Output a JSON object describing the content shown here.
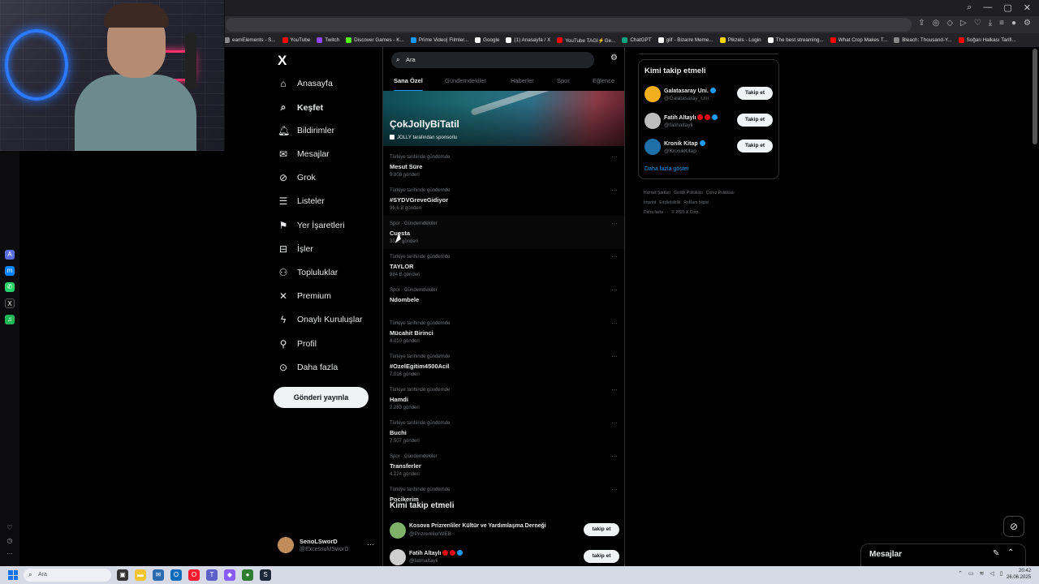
{
  "browser": {
    "bookmarks": [
      {
        "label": "eamElements - S...",
        "color": "#888888"
      },
      {
        "label": "YouTube",
        "color": "#ff0000"
      },
      {
        "label": "Twitch",
        "color": "#9146ff"
      },
      {
        "label": "Discover Games - K...",
        "color": "#53fc18"
      },
      {
        "label": "Prime Video| Filmler...",
        "color": "#1399ff"
      },
      {
        "label": "Google",
        "color": "#ffffff"
      },
      {
        "label": "(1) Anasayfa / X",
        "color": "#ffffff"
      },
      {
        "label": "YouTube TAGI⚡Ge...",
        "color": "#ff0000"
      },
      {
        "label": "ChatGPT",
        "color": "#10a37f"
      },
      {
        "label": "glif - Bizarre Meme...",
        "color": "#ffffff"
      },
      {
        "label": "Pikzels - Login",
        "color": "#ffd400"
      },
      {
        "label": "The best streaming...",
        "color": "#ffffff"
      },
      {
        "label": "What Crop Makes T...",
        "color": "#ff0000"
      },
      {
        "label": "Bleach: Thousand-Y...",
        "color": "#888888"
      },
      {
        "label": "Soğan Halkası Tarifi...",
        "color": "#ff0000"
      }
    ]
  },
  "sidebar": {
    "logo": "X",
    "items": [
      {
        "label": "Anasayfa",
        "icon": "home-icon",
        "glyph": "⌂"
      },
      {
        "label": "Keşfet",
        "icon": "search-icon",
        "glyph": "⌕",
        "active": true
      },
      {
        "label": "Bildirimler",
        "icon": "bell-icon",
        "glyph": "🔔︎"
      },
      {
        "label": "Mesajlar",
        "icon": "mail-icon",
        "glyph": "✉"
      },
      {
        "label": "Grok",
        "icon": "grok-icon",
        "glyph": "⊘"
      },
      {
        "label": "Listeler",
        "icon": "list-icon",
        "glyph": "☰"
      },
      {
        "label": "Yer İşaretleri",
        "icon": "bookmark-icon",
        "glyph": "⚑"
      },
      {
        "label": "İşler",
        "icon": "briefcase-icon",
        "glyph": "⊟"
      },
      {
        "label": "Topluluklar",
        "icon": "people-icon",
        "glyph": "⚇"
      },
      {
        "label": "Premium",
        "icon": "x-premium-icon",
        "glyph": "✕"
      },
      {
        "label": "Onaylı Kuruluşlar",
        "icon": "lightning-icon",
        "glyph": "ϟ"
      },
      {
        "label": "Profil",
        "icon": "person-icon",
        "glyph": "⚲"
      },
      {
        "label": "Daha fazla",
        "icon": "more-circle-icon",
        "glyph": "⊙"
      }
    ],
    "post_button": "Gönderi yayınla",
    "account": {
      "name": "SenoLSworD",
      "handle": "@ExcessuMSworD",
      "more": "···"
    }
  },
  "explore": {
    "search_placeholder": "Ara",
    "tabs": [
      "Sana Özel",
      "Gündemdekiler",
      "Haberler",
      "Spor",
      "Eğlence"
    ],
    "banner": {
      "title": "ÇokJollyBiTatil",
      "sponsor": "JOLLY tarafından sponsorlu"
    },
    "trends": [
      {
        "context": "Türkiye tarihinde gündemde",
        "title": "Mesut Süre",
        "count": "9.808 gönderi"
      },
      {
        "context": "Türkiye tarihinde gündemde",
        "title": "#SYDVGreveGidiyor",
        "count": "96,6 B gönderi"
      },
      {
        "context": "Spor · Gündemdekiler",
        "title": "Cuesta",
        "count": "33,... gönderi"
      },
      {
        "context": "Türkiye tarihinde gündemde",
        "title": "TAYLOR",
        "count": "984 B gönderi"
      },
      {
        "context": "Spor · Gündemdekiler",
        "title": "Ndombele",
        "count": ""
      },
      {
        "context": "Türkiye tarihinde gündemde",
        "title": "Mücahit Birinci",
        "count": "4.010 gönderi"
      },
      {
        "context": "Türkiye tarihinde gündemde",
        "title": "#OzelEgitim4500Acil",
        "count": "7.016 gönderi"
      },
      {
        "context": "Türkiye tarihinde gündemde",
        "title": "Hamdi",
        "count": "2.283 gönderi"
      },
      {
        "context": "Türkiye tarihinde gündemde",
        "title": "Buchi",
        "count": "7.507 gönderi"
      },
      {
        "context": "Spor · Gündemdekiler",
        "title": "Transferler",
        "count": "4.224 gönderi"
      },
      {
        "context": "Türkiye tarihinde gündemde",
        "title": "Pocikerim",
        "count": ""
      }
    ],
    "who_to_follow": {
      "title": "Kimi takip etmeli",
      "accounts": [
        {
          "name": "Kosova Prizrenliler Kültür ve Yardımlaşma Derneği",
          "handle": "@PrizrenlilerWEB",
          "button": "takip et",
          "color": "#7fb36a"
        },
        {
          "name": "Fatih Altaylı",
          "handle": "@fatihaltayli",
          "button": "takip et",
          "color": "#cfcfcf"
        }
      ]
    }
  },
  "right": {
    "who_to_follow": {
      "title": "Kimi takip etmeli",
      "accounts": [
        {
          "name": "Galatasaray Uni.",
          "handle": "@Galatasaray_Uni",
          "button": "Takip et",
          "color": "#f3b01a"
        },
        {
          "name": "Fatih Altaylı",
          "handle": "@fatihaltayli",
          "button": "Takip et",
          "color": "#bdbdbd"
        },
        {
          "name": "Kronik Kitap",
          "handle": "@KronikKitap",
          "button": "Takip et",
          "color": "#1e6fa8"
        }
      ],
      "more": "Daha fazla göster"
    },
    "footer": [
      "Hizmet Şartları",
      "Gizlilik Politikası",
      "Çerez Politikası",
      "Imprint",
      "Erişilebilirlik",
      "Reklam bilgisi",
      "Daha fazla ···",
      "© 2025 X Corp."
    ]
  },
  "drawer": {
    "title": "Mesajlar"
  },
  "taskbar": {
    "search": "Ara",
    "time": "20:42",
    "date": "26.06.2025"
  },
  "colors": {
    "accent": "#1d9bf0",
    "background": "#000000"
  }
}
